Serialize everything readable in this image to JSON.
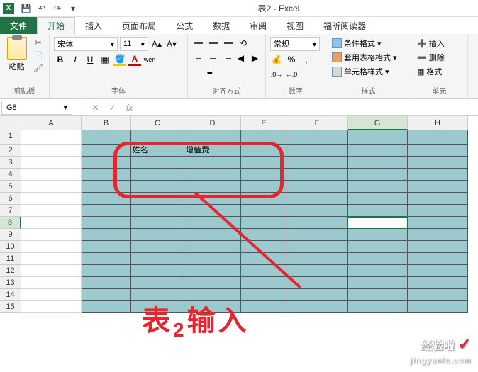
{
  "title": "表2 - Excel",
  "qat": {
    "save": "💾",
    "undo": "↶",
    "redo": "↷",
    "more": "▾"
  },
  "tabs": {
    "file": "文件",
    "home": "开始",
    "insert": "插入",
    "layout": "页面布局",
    "formula": "公式",
    "data": "数据",
    "review": "审阅",
    "view": "视图",
    "foxit": "福昕阅读器"
  },
  "ribbon": {
    "clipboard": {
      "paste": "粘贴",
      "label": "剪贴板"
    },
    "font": {
      "name": "宋体",
      "size": "11",
      "label": "字体",
      "wen": "wén"
    },
    "align": {
      "label": "对齐方式"
    },
    "number": {
      "format": "常规",
      "label": "数字"
    },
    "styles": {
      "conditional": "条件格式",
      "table": "套用表格格式",
      "cell": "单元格样式",
      "label": "样式"
    },
    "cells": {
      "insert": "插入",
      "delete": "删除",
      "format": "格式",
      "label": "单元"
    }
  },
  "namebox": "G8",
  "columns": [
    "A",
    "B",
    "C",
    "D",
    "E",
    "F",
    "G",
    "H"
  ],
  "rows": [
    "1",
    "2",
    "3",
    "4",
    "5",
    "6",
    "7",
    "8",
    "9",
    "10",
    "11",
    "12",
    "13",
    "14",
    "15"
  ],
  "cells": {
    "C2": "姓名",
    "D2": "增值费"
  },
  "selected_cell": "G8",
  "chart_data": {
    "type": "table",
    "columns": [
      "姓名",
      "增值费"
    ],
    "rows": []
  },
  "annotation_text": "表2输入",
  "watermark": {
    "brand": "经验啦",
    "domain": "jingyanla.com",
    "check": "✓"
  }
}
